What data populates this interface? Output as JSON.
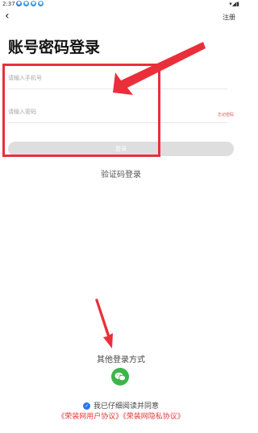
{
  "status_bar": {
    "time": "2:37"
  },
  "header": {
    "back_icon": "back-arrow-icon",
    "register_label": "注册"
  },
  "title": "账号密码登录",
  "form": {
    "phone_placeholder": "请输入手机号",
    "password_placeholder": "请输入密码",
    "forgot_password": "忘记密码",
    "login_button": "登录"
  },
  "sms_login_label": "验证码登录",
  "other_login": {
    "label": "其他登录方式",
    "wechat_icon": "wechat-icon"
  },
  "agreement": {
    "text": "我已仔细阅读并同意",
    "links": "《荣装网用户协议》《荣装网隐私协议》"
  },
  "colors": {
    "annotation": "#ea2f3b",
    "wechat": "#3cb54a",
    "checkbox": "#2a74e8",
    "link": "#e4393c"
  }
}
